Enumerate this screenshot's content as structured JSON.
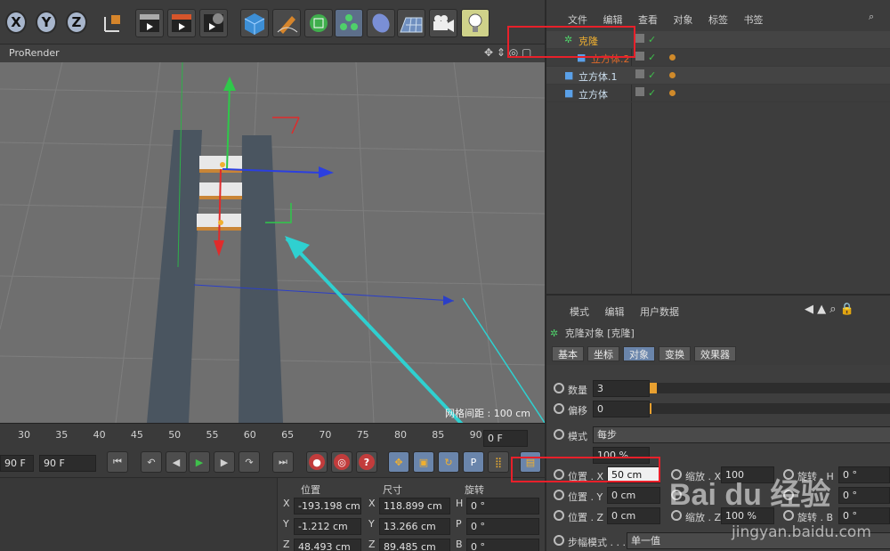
{
  "toolbar": {
    "axis_buttons": [
      "X",
      "Y",
      "Z"
    ],
    "icons": [
      "world-coord-icon",
      "render-view-icon",
      "render-picture-icon",
      "render-settings-icon",
      "cube-icon",
      "pen-icon",
      "subdivision-icon",
      "cloner-icon",
      "deformer-icon",
      "floor-icon",
      "camera-icon",
      "light-icon"
    ]
  },
  "viewport": {
    "label": "ProRender",
    "grid_distance": "网格间距 : 100 cm"
  },
  "object_manager": {
    "menu": [
      "文件",
      "编辑",
      "查看",
      "对象",
      "标签",
      "书签"
    ],
    "objects": [
      {
        "name": "克隆",
        "icon": "cloner-icon",
        "indent": 0,
        "highlighted": true
      },
      {
        "name": "立方体.2",
        "icon": "cube-icon",
        "indent": 1,
        "highlighted": false
      },
      {
        "name": "立方体.1",
        "icon": "cube-icon",
        "indent": 0,
        "highlighted": false
      },
      {
        "name": "立方体",
        "icon": "cube-icon",
        "indent": 0,
        "highlighted": false
      }
    ]
  },
  "attributes": {
    "menu": [
      "模式",
      "编辑",
      "用户数据"
    ],
    "title": "克隆对象 [克隆]",
    "tabs": [
      "基本",
      "坐标",
      "对象",
      "变换",
      "效果器"
    ],
    "selected_tab": "对象",
    "count_label": "数量",
    "count_value": "3",
    "offset_label": "偏移",
    "offset_value": "0",
    "mode_label": "模式",
    "mode_value": "每步",
    "percent_value": "100 %",
    "pos_x_label": "位置 . X",
    "pos_x_value": "50 cm",
    "pos_y_label": "位置 . Y",
    "pos_y_value": "0 cm",
    "pos_z_label": "位置 . Z",
    "pos_z_value": "0 cm",
    "scale_x_label": "缩放 . X",
    "scale_x_value": "100",
    "scale_z_label": "缩放 . Z",
    "scale_z_value": "100 %",
    "rot_h_label": "旋转 . H",
    "rot_h_value": "0 °",
    "rot_b_label": "旋转 . B",
    "rot_b_value": "0 °",
    "rot_p_value": "0 °",
    "step_mode_label": "步幅模式 . . .",
    "step_mode_value": "单一值"
  },
  "timeline": {
    "ticks": [
      "30",
      "35",
      "40",
      "45",
      "50",
      "55",
      "60",
      "65",
      "70",
      "75",
      "80",
      "85",
      "90"
    ],
    "current_frame": "0 F",
    "end_frame_left": "90 F",
    "end_frame": "90 F"
  },
  "coordinates": {
    "headers": [
      "位置",
      "尺寸",
      "旋转"
    ],
    "rows": [
      {
        "axis": "X",
        "pos": "-193.198 cm",
        "size_axis": "X",
        "size": "118.899 cm",
        "rot_axis": "H",
        "rot": "0 °"
      },
      {
        "axis": "Y",
        "pos": "-1.212 cm",
        "size_axis": "Y",
        "size": "13.266 cm",
        "rot_axis": "P",
        "rot": "0 °"
      },
      {
        "axis": "Z",
        "pos": "48.493 cm",
        "size_axis": "Z",
        "size": "89.485 cm",
        "rot_axis": "B",
        "rot": "0 °"
      }
    ]
  },
  "watermark": {
    "brand": "Bai du 经验",
    "url": "jingyan.baidu.com"
  },
  "colors": {
    "highlight_box": "#e8202a",
    "arrow": "#2fd0d0",
    "tab_selected": "#6a85ab"
  }
}
